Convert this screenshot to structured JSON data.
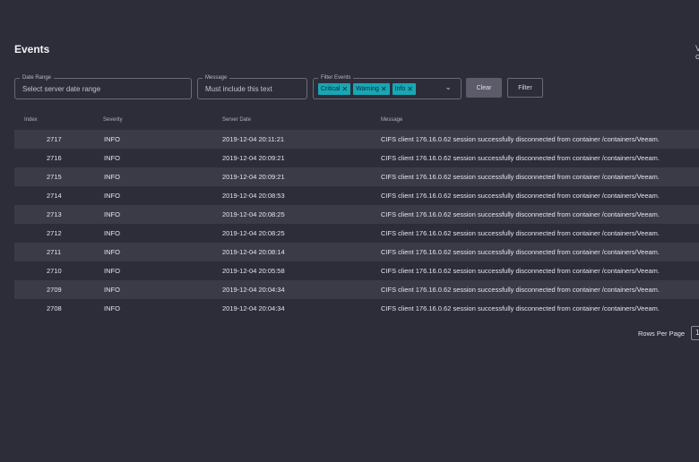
{
  "page": {
    "title": "Events",
    "edge_text": "V\nc"
  },
  "filters": {
    "date_range": {
      "label": "Date Range",
      "placeholder": "Select server date range"
    },
    "message": {
      "label": "Message",
      "placeholder": "Must include this text"
    },
    "filter_events": {
      "label": "Filter Events",
      "chips": [
        "Critical",
        "Warning",
        "Info"
      ]
    },
    "clear_label": "Clear",
    "filter_label": "Filter"
  },
  "table": {
    "headers": {
      "index": "Index",
      "severity": "Severity",
      "server_date": "Server Date",
      "message": "Message"
    },
    "rows": [
      {
        "index": "2717",
        "severity": "INFO",
        "date": "2019-12-04 20:11:21",
        "message": "CIFS client 176.16.0.62 session successfully disconnected from container /containers/Veeam."
      },
      {
        "index": "2716",
        "severity": "INFO",
        "date": "2019-12-04 20:09:21",
        "message": "CIFS client 176.16.0.62 session successfully disconnected from container /containers/Veeam."
      },
      {
        "index": "2715",
        "severity": "INFO",
        "date": "2019-12-04 20:09:21",
        "message": "CIFS client 176.16.0.62 session successfully disconnected from container /containers/Veeam."
      },
      {
        "index": "2714",
        "severity": "INFO",
        "date": "2019-12-04 20:08:53",
        "message": "CIFS client 176.16.0.62 session successfully disconnected from container /containers/Veeam."
      },
      {
        "index": "2713",
        "severity": "INFO",
        "date": "2019-12-04 20:08:25",
        "message": "CIFS client 176.16.0.62 session successfully disconnected from container /containers/Veeam."
      },
      {
        "index": "2712",
        "severity": "INFO",
        "date": "2019-12-04 20:08:25",
        "message": "CIFS client 176.16.0.62 session successfully disconnected from container /containers/Veeam."
      },
      {
        "index": "2711",
        "severity": "INFO",
        "date": "2019-12-04 20:08:14",
        "message": "CIFS client 176.16.0.62 session successfully disconnected from container /containers/Veeam."
      },
      {
        "index": "2710",
        "severity": "INFO",
        "date": "2019-12-04 20:05:58",
        "message": "CIFS client 176.16.0.62 session successfully disconnected from container /containers/Veeam."
      },
      {
        "index": "2709",
        "severity": "INFO",
        "date": "2019-12-04 20:04:34",
        "message": "CIFS client 176.16.0.62 session successfully disconnected from container /containers/Veeam."
      },
      {
        "index": "2708",
        "severity": "INFO",
        "date": "2019-12-04 20:04:34",
        "message": "CIFS client 176.16.0.62 session successfully disconnected from container /containers/Veeam."
      }
    ]
  },
  "pagination": {
    "rows_per_page_label": "Rows Per Page",
    "rows_per_page_value": "1"
  },
  "colors": {
    "background": "#2d2d39",
    "row_stripe": "#3b3b48",
    "chip": "#17a7b5",
    "clear_button": "#5b5b69"
  },
  "icons": {
    "chip_remove": "close-icon",
    "dropdown": "chevron-down-icon"
  }
}
